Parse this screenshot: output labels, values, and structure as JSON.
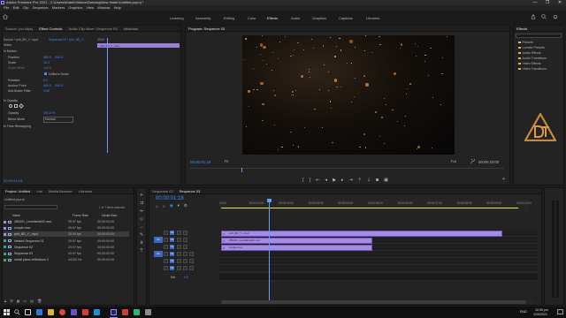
{
  "window": {
    "title": "Adobe Premiere Pro 2021 - C:\\Users\\khanh\\Videos\\Dancing\\New folder\\Untitled.prproj *",
    "controls": [
      "—",
      "❐",
      "✕"
    ]
  },
  "menu": [
    "File",
    "Edit",
    "Clip",
    "Sequence",
    "Markers",
    "Graphics",
    "View",
    "Window",
    "Help"
  ],
  "workspaces": [
    "Learning",
    "Assembly",
    "Editing",
    "Color",
    "Effects",
    "Audio",
    "Graphics",
    "Captions",
    "Libraries"
  ],
  "active_workspace": "Effects",
  "effect_controls": {
    "tabs": [
      "Source: (no clips)",
      "Effect Controls",
      "Audio Clip Mixer: Sequence 03",
      "Metadata"
    ],
    "active_tab": "Effect Controls",
    "source_label": "Source * pnh_8D_Y...mp4",
    "sequence_label": "Sequence 03 * pnh_8D_Y...",
    "timecode_start": "00:00",
    "clip_label": "pnh_8D_Y_mp4",
    "video_label": "Video",
    "motion_label": "Motion",
    "position": {
      "label": "Position",
      "x": "960.0",
      "y": "540.0"
    },
    "scale": {
      "label": "Scale",
      "value": "10.0"
    },
    "scale_width": {
      "label": "Scale Width",
      "value": "100.0"
    },
    "uniform_scale": "Uniform Scale",
    "rotation": {
      "label": "Rotation",
      "value": "0.0"
    },
    "anchor_point": {
      "label": "Anchor Point",
      "x": "960.0",
      "y": "540.0"
    },
    "anti_flicker": {
      "label": "Anti-flicker Filter",
      "value": "0.00"
    },
    "opacity_label": "Opacity",
    "opacity": {
      "label": "Opacity",
      "value": "100.0 %"
    },
    "blend_mode": {
      "label": "Blend Mode",
      "value": "Normal"
    },
    "time_remapping": "Time Remapping",
    "current_time": "00:00:01:18"
  },
  "program": {
    "title": "Program: Sequence 03",
    "timecode": "00:00:01:18",
    "fit": "Fit",
    "quality": "Full",
    "duration": "00:00:10:00"
  },
  "effects": {
    "title": "Effects",
    "items": [
      "Presets",
      "Lumetri Presets",
      "Audio Effects",
      "Audio Transitions",
      "Video Effects",
      "Video Transitions"
    ]
  },
  "project": {
    "tabs": [
      "Project: Untitled",
      "Info",
      "Media Browser",
      "Libraries"
    ],
    "file": "Untitled.prproj",
    "count": "1 of 7 items selected",
    "columns": [
      "Name",
      "Frame Rate",
      "Media Start"
    ],
    "rows": [
      {
        "name": "280401_Levelfame02.mov",
        "fps": "29.97 fps",
        "start": "00:00:00:00",
        "color": "#a48be6",
        "selected": false
      },
      {
        "name": "couple.mov",
        "fps": "29.97 fps",
        "start": "00:00:00:00",
        "color": "#a48be6",
        "selected": false
      },
      {
        "name": "pnh_8D_Y_.mp4",
        "fps": "25.00 fps",
        "start": "00:00:00:00",
        "color": "#a48be6",
        "selected": true
      },
      {
        "name": "Nested Sequence 01",
        "fps": "29.97 fps",
        "start": "00:00:00:00",
        "color": "#2fa38d",
        "selected": false
      },
      {
        "name": "Sequence 02",
        "fps": "29.97 fps",
        "start": "00:00:00:00",
        "color": "#2fa38d",
        "selected": false
      },
      {
        "name": "Sequence 03",
        "fps": "29.97 fps",
        "start": "00:00:00:00",
        "color": "#2fa38d",
        "selected": false
      },
      {
        "name": "metal piano reflections 2",
        "fps": "44100 Hz",
        "start": "00:00:00:00",
        "color": "#3fae4d",
        "selected": false
      }
    ]
  },
  "timeline": {
    "tabs": [
      "Sequence 02",
      "Sequence 03"
    ],
    "active_tab": "Sequence 03",
    "timecode": "00:00:01:18",
    "ruler": [
      "00:00",
      "00:00:01:00",
      "00:00:02:00",
      "00:00:03:00",
      "00:00:04:00",
      "00:00:05:00",
      "00:00:06:00",
      "00:00:07:00",
      "00:00:08:00",
      "00:00:09:00",
      "00:00:10:00"
    ],
    "video_tracks": [
      "V3",
      "V2",
      "V1"
    ],
    "audio_tracks": [
      "A1",
      "A2",
      "A3"
    ],
    "mix_label": "Mix",
    "mix_value": "0.0",
    "clips": [
      {
        "label": "pnh_8D_Y_.mp4",
        "track": "V3",
        "start": 0,
        "end": 9.45
      },
      {
        "label": "280401_Levelfame02.mov",
        "track": "V2",
        "start": 0,
        "end": 5.1
      },
      {
        "label": "couple.mov",
        "track": "V1",
        "start": 0,
        "end": 5.1
      }
    ],
    "playhead_seconds": 1.6,
    "total_seconds": 10
  },
  "taskbar": {
    "time": "10:55 pm",
    "date": "2/20/2021",
    "lang": "ENG"
  },
  "colors": {
    "accent": "#3d8aff",
    "clip_purple": "#a48be6",
    "workarea": "#e8e14a"
  }
}
